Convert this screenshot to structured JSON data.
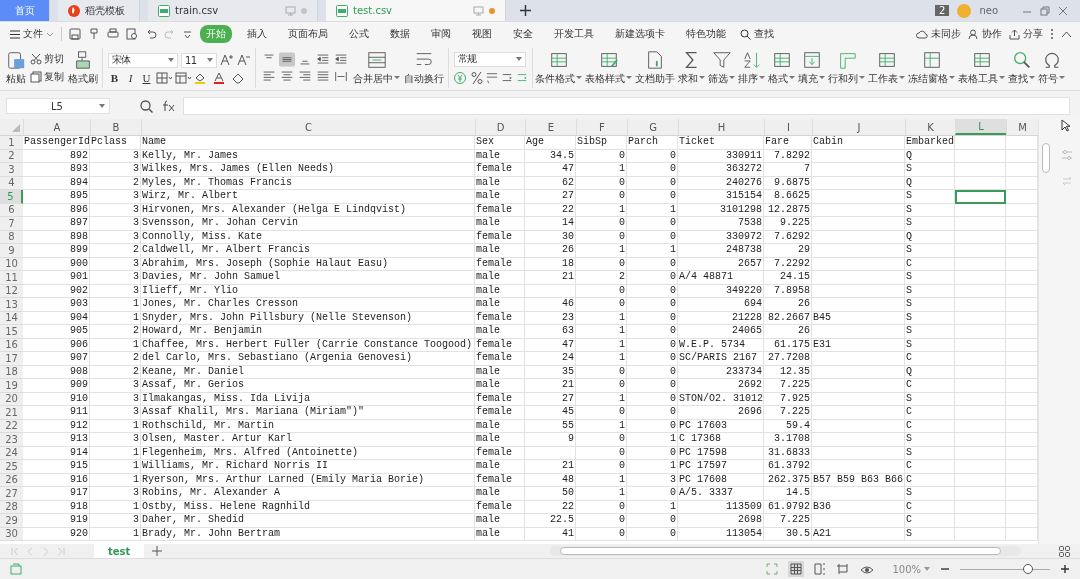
{
  "top_tabs": [
    {
      "label": "首页",
      "kind": "home",
      "selected": false
    },
    {
      "label": "稻壳模板",
      "kind": "template",
      "selected": false
    },
    {
      "label": "train.csv",
      "kind": "csv",
      "selected": false,
      "modified": false
    },
    {
      "label": "test.csv",
      "kind": "csv",
      "selected": true,
      "modified": true
    }
  ],
  "window_count": "2",
  "user": "neo",
  "menu": {
    "file": "文件",
    "tabs": [
      {
        "label": "开始",
        "selected": true
      },
      {
        "label": "插入",
        "selected": false
      },
      {
        "label": "页面布局",
        "selected": false
      },
      {
        "label": "公式",
        "selected": false
      },
      {
        "label": "数据",
        "selected": false
      },
      {
        "label": "审阅",
        "selected": false
      },
      {
        "label": "视图",
        "selected": false
      },
      {
        "label": "安全",
        "selected": false
      },
      {
        "label": "开发工具",
        "selected": false
      },
      {
        "label": "新建选项卡",
        "selected": false
      },
      {
        "label": "特色功能",
        "selected": false
      }
    ],
    "search": "查找",
    "sync": "未同步",
    "collab": "协作",
    "share": "分享"
  },
  "ribbon": {
    "paste": "粘贴",
    "cut": "剪切",
    "copy": "复制",
    "painter": "格式刷",
    "font_name": "宋体",
    "font_size": "11",
    "bold": "B",
    "italic": "I",
    "underline": "U",
    "alignment": [
      {
        "kind": "top",
        "selected": false
      },
      {
        "kind": "middle",
        "selected": true
      },
      {
        "kind": "bottom",
        "selected": false
      },
      {
        "kind": "outdent",
        "selected": false
      },
      {
        "kind": "indent",
        "selected": false
      },
      {
        "kind": "left",
        "selected": false
      },
      {
        "kind": "center",
        "selected": false
      },
      {
        "kind": "right",
        "selected": false
      },
      {
        "kind": "justify",
        "selected": false
      },
      {
        "kind": "distributed",
        "selected": false
      }
    ],
    "merge": "合并居中",
    "wrap": "自动换行",
    "number_format": "常规",
    "tools": [
      {
        "label": "条件格式",
        "kind": "table",
        "dropdown": true
      },
      {
        "label": "表格样式",
        "kind": "table-pen",
        "dropdown": true
      },
      {
        "label": "文档助手",
        "kind": "document",
        "dropdown": false
      },
      {
        "label": "求和",
        "kind": "sigma",
        "dropdown": true
      },
      {
        "label": "筛选",
        "kind": "funnel",
        "dropdown": true
      },
      {
        "label": "排序",
        "kind": "sort",
        "dropdown": true
      },
      {
        "label": "格式",
        "kind": "table",
        "dropdown": true
      },
      {
        "label": "填充",
        "kind": "fill",
        "dropdown": true
      },
      {
        "label": "行和列",
        "kind": "rows",
        "dropdown": true
      },
      {
        "label": "工作表",
        "kind": "table",
        "dropdown": true
      },
      {
        "label": "冻结窗格",
        "kind": "freeze",
        "dropdown": true
      },
      {
        "label": "表格工具",
        "kind": "table",
        "dropdown": true
      },
      {
        "label": "查找",
        "kind": "search",
        "dropdown": true
      },
      {
        "label": "符号",
        "kind": "omega",
        "dropdown": true
      }
    ]
  },
  "name_box": "L5",
  "columns": [
    {
      "letter": "A",
      "selected": false
    },
    {
      "letter": "B",
      "selected": false
    },
    {
      "letter": "C",
      "selected": false
    },
    {
      "letter": "D",
      "selected": false
    },
    {
      "letter": "E",
      "selected": false
    },
    {
      "letter": "F",
      "selected": false
    },
    {
      "letter": "G",
      "selected": false
    },
    {
      "letter": "H",
      "selected": false
    },
    {
      "letter": "I",
      "selected": false
    },
    {
      "letter": "J",
      "selected": false
    },
    {
      "letter": "K",
      "selected": false
    },
    {
      "letter": "L",
      "selected": true
    },
    {
      "letter": "M",
      "selected": false
    }
  ],
  "rows": [
    {
      "number": "1",
      "selected": false,
      "cells": [
        "PassengerId",
        "Pclass",
        "Name",
        "Sex",
        "Age",
        "SibSp",
        "Parch",
        "Ticket",
        "Fare",
        "Cabin",
        "Embarked"
      ]
    },
    {
      "number": "2",
      "selected": false,
      "cells": [
        "892",
        "3",
        "Kelly, Mr. James",
        "male",
        "34.5",
        "0",
        "0",
        "330911",
        "7.8292",
        null,
        "Q"
      ]
    },
    {
      "number": "3",
      "selected": false,
      "cells": [
        "893",
        "3",
        "Wilkes, Mrs. James (Ellen Needs)",
        "female",
        "47",
        "1",
        "0",
        "363272",
        "7",
        null,
        "S"
      ]
    },
    {
      "number": "4",
      "selected": false,
      "cells": [
        "894",
        "2",
        "Myles, Mr. Thomas Francis",
        "male",
        "62",
        "0",
        "0",
        "240276",
        "9.6875",
        null,
        "Q"
      ]
    },
    {
      "number": "5",
      "selected": true,
      "cells": [
        "895",
        "3",
        "Wirz, Mr. Albert",
        "male",
        "27",
        "0",
        "0",
        "315154",
        "8.6625",
        null,
        "S"
      ]
    },
    {
      "number": "6",
      "selected": false,
      "cells": [
        "896",
        "3",
        "Hirvonen, Mrs. Alexander (Helga E Lindqvist)",
        "female",
        "22",
        "1",
        "1",
        "3101298",
        "12.2875",
        null,
        "S"
      ]
    },
    {
      "number": "7",
      "selected": false,
      "cells": [
        "897",
        "3",
        "Svensson, Mr. Johan Cervin",
        "male",
        "14",
        "0",
        "0",
        "7538",
        "9.225",
        null,
        "S"
      ]
    },
    {
      "number": "8",
      "selected": false,
      "cells": [
        "898",
        "3",
        "Connolly, Miss. Kate",
        "female",
        "30",
        "0",
        "0",
        "330972",
        "7.6292",
        null,
        "Q"
      ]
    },
    {
      "number": "9",
      "selected": false,
      "cells": [
        "899",
        "2",
        "Caldwell, Mr. Albert Francis",
        "male",
        "26",
        "1",
        "1",
        "248738",
        "29",
        null,
        "S"
      ]
    },
    {
      "number": "10",
      "selected": false,
      "cells": [
        "900",
        "3",
        "Abrahim, Mrs. Joseph (Sophie Halaut Easu)",
        "female",
        "18",
        "0",
        "0",
        "2657",
        "7.2292",
        null,
        "C"
      ]
    },
    {
      "number": "11",
      "selected": false,
      "cells": [
        "901",
        "3",
        "Davies, Mr. John Samuel",
        "male",
        "21",
        "2",
        "0",
        "A/4 48871",
        "24.15",
        null,
        "S"
      ]
    },
    {
      "number": "12",
      "selected": false,
      "cells": [
        "902",
        "3",
        "Ilieff, Mr. Ylio",
        "male",
        null,
        "0",
        "0",
        "349220",
        "7.8958",
        null,
        "S"
      ]
    },
    {
      "number": "13",
      "selected": false,
      "cells": [
        "903",
        "1",
        "Jones, Mr. Charles Cresson",
        "male",
        "46",
        "0",
        "0",
        "694",
        "26",
        null,
        "S"
      ]
    },
    {
      "number": "14",
      "selected": false,
      "cells": [
        "904",
        "1",
        "Snyder, Mrs. John Pillsbury (Nelle Stevenson)",
        "female",
        "23",
        "1",
        "0",
        "21228",
        "82.2667",
        "B45",
        "S"
      ]
    },
    {
      "number": "15",
      "selected": false,
      "cells": [
        "905",
        "2",
        "Howard, Mr. Benjamin",
        "male",
        "63",
        "1",
        "0",
        "24065",
        "26",
        null,
        "S"
      ]
    },
    {
      "number": "16",
      "selected": false,
      "cells": [
        "906",
        "1",
        "Chaffee, Mrs. Herbert Fuller (Carrie Constance Toogood)",
        "female",
        "47",
        "1",
        "0",
        "W.E.P. 5734",
        "61.175",
        "E31",
        "S"
      ]
    },
    {
      "number": "17",
      "selected": false,
      "cells": [
        "907",
        "2",
        "del Carlo, Mrs. Sebastiano (Argenia Genovesi)",
        "female",
        "24",
        "1",
        "0",
        "SC/PARIS 2167",
        "27.7208",
        null,
        "C"
      ]
    },
    {
      "number": "18",
      "selected": false,
      "cells": [
        "908",
        "2",
        "Keane, Mr. Daniel",
        "male",
        "35",
        "0",
        "0",
        "233734",
        "12.35",
        null,
        "Q"
      ]
    },
    {
      "number": "19",
      "selected": false,
      "cells": [
        "909",
        "3",
        "Assaf, Mr. Gerios",
        "male",
        "21",
        "0",
        "0",
        "2692",
        "7.225",
        null,
        "C"
      ]
    },
    {
      "number": "20",
      "selected": false,
      "cells": [
        "910",
        "3",
        "Ilmakangas, Miss. Ida Livija",
        "female",
        "27",
        "1",
        "0",
        "STON/O2. 31012",
        "7.925",
        null,
        "S"
      ]
    },
    {
      "number": "21",
      "selected": false,
      "cells": [
        "911",
        "3",
        "Assaf Khalil, Mrs. Mariana (Miriam\")\"",
        "female",
        "45",
        "0",
        "0",
        "2696",
        "7.225",
        null,
        "C"
      ]
    },
    {
      "number": "22",
      "selected": false,
      "cells": [
        "912",
        "1",
        "Rothschild, Mr. Martin",
        "male",
        "55",
        "1",
        "0",
        "PC 17603",
        "59.4",
        null,
        "C"
      ]
    },
    {
      "number": "23",
      "selected": false,
      "cells": [
        "913",
        "3",
        "Olsen, Master. Artur Karl",
        "male",
        "9",
        "0",
        "1",
        "C 17368",
        "3.1708",
        null,
        "S"
      ]
    },
    {
      "number": "24",
      "selected": false,
      "cells": [
        "914",
        "1",
        "Flegenheim, Mrs. Alfred (Antoinette)",
        "female",
        null,
        "0",
        "0",
        "PC 17598",
        "31.6833",
        null,
        "S"
      ]
    },
    {
      "number": "25",
      "selected": false,
      "cells": [
        "915",
        "1",
        "Williams, Mr. Richard Norris II",
        "male",
        "21",
        "0",
        "1",
        "PC 17597",
        "61.3792",
        null,
        "C"
      ]
    },
    {
      "number": "26",
      "selected": false,
      "cells": [
        "916",
        "1",
        "Ryerson, Mrs. Arthur Larned (Emily Maria Borie)",
        "female",
        "48",
        "1",
        "3",
        "PC 17608",
        "262.375",
        "B57 B59 B63 B66",
        "C"
      ]
    },
    {
      "number": "27",
      "selected": false,
      "cells": [
        "917",
        "3",
        "Robins, Mr. Alexander A",
        "male",
        "50",
        "1",
        "0",
        "A/5. 3337",
        "14.5",
        null,
        "S"
      ]
    },
    {
      "number": "28",
      "selected": false,
      "cells": [
        "918",
        "1",
        "Ostby, Miss. Helene Ragnhild",
        "female",
        "22",
        "0",
        "1",
        "113509",
        "61.9792",
        "B36",
        "C"
      ]
    },
    {
      "number": "29",
      "selected": false,
      "cells": [
        "919",
        "3",
        "Daher, Mr. Shedid",
        "male",
        "22.5",
        "0",
        "0",
        "2698",
        "7.225",
        null,
        "C"
      ]
    },
    {
      "number": "30",
      "selected": false,
      "cells": [
        "920",
        "1",
        "Brady, Mr. John Bertram",
        "male",
        "41",
        "0",
        "0",
        "113054",
        "30.5",
        "A21",
        "S"
      ]
    }
  ],
  "sheet_tabs": [
    {
      "label": "test",
      "selected": true
    }
  ],
  "zoom": {
    "label": "100%",
    "level": 0.75
  }
}
